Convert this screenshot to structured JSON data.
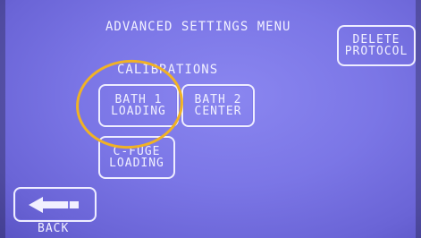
{
  "screen": {
    "title": "ADVANCED SETTINGS MENU",
    "section_label": "CALIBRATIONS"
  },
  "buttons": {
    "delete_protocol": {
      "line1": "DELETE",
      "line2": "PROTOCOL"
    },
    "bath1_loading": {
      "line1": "BATH 1",
      "line2": "LOADING"
    },
    "bath2_center": {
      "line1": "BATH 2",
      "line2": "CENTER"
    },
    "cfuge_loading": {
      "line1": "C-FUGE",
      "line2": "LOADING"
    },
    "back": {
      "label": "BACK",
      "icon": "back-arrow-icon"
    }
  },
  "colors": {
    "screen_background": "#7b76e6",
    "text": "#f1f0ff",
    "highlight_circle": "#f0b225"
  }
}
